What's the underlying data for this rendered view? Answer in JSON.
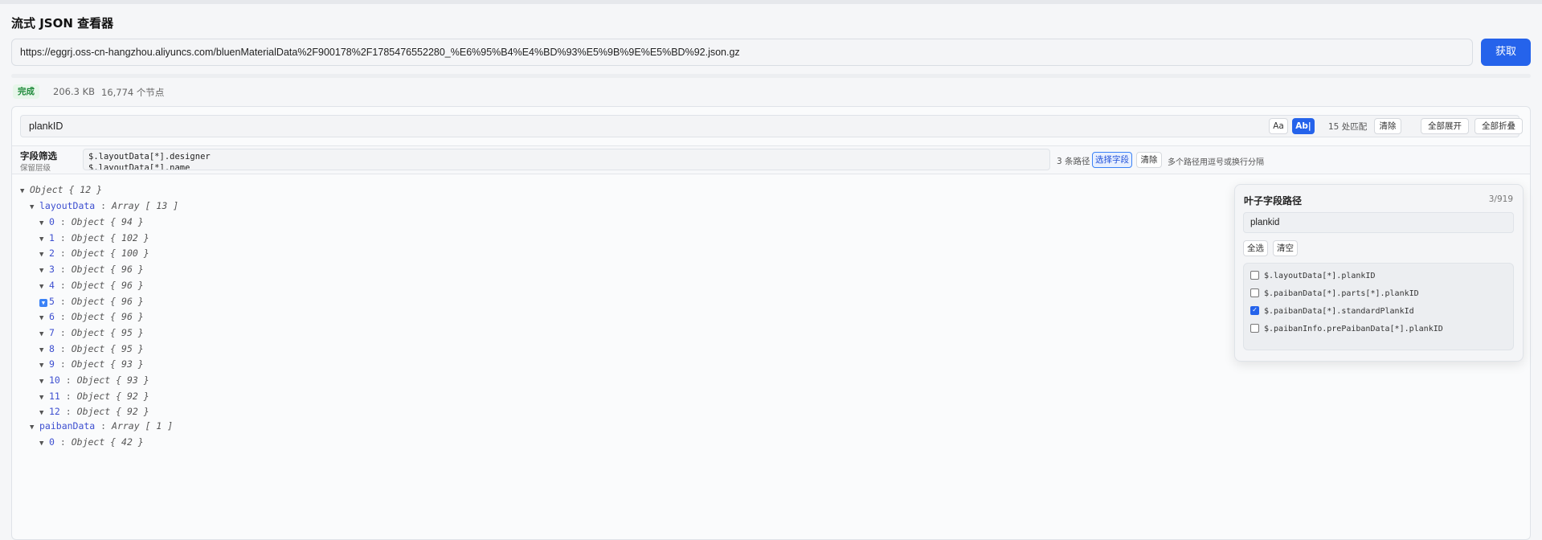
{
  "app": {
    "title": "流式 JSON 查看器"
  },
  "url_bar": {
    "value": "https://eggrj.oss-cn-hangzhou.aliyuncs.com/bluenMaterialData%2F900178%2F1785476552280_%E6%95%B4%E4%BD%93%E5%9B%9E%E5%BD%92.json.gz",
    "fetch_label": "获取"
  },
  "status": {
    "badge": "完成",
    "size": "206.3 KB",
    "nodes": "16,774 个节点"
  },
  "search": {
    "value": "plankID",
    "case_label": "Aa",
    "word_label": "Ab|",
    "match_count": "15 处匹配",
    "clear_label": "清除",
    "expand_all": "全部展开",
    "collapse_all": "全部折叠"
  },
  "field_filter": {
    "title": "字段筛选",
    "subtitle": "保留层级",
    "lines": [
      "$.layoutData[*].designer",
      "$.layoutData[*].name"
    ],
    "path_count": "3 条路径",
    "select_label": "选择字段",
    "clear_label": "清除",
    "hint": "多个路径用逗号或换行分隔"
  },
  "tree": {
    "root_type": "Object { 12 }",
    "layoutData": {
      "key": "layoutData",
      "type": "Array [ 13 ]"
    },
    "layout_items": [
      {
        "key": "0",
        "type": "Object { 94 }"
      },
      {
        "key": "1",
        "type": "Object { 102 }"
      },
      {
        "key": "2",
        "type": "Object { 100 }"
      },
      {
        "key": "3",
        "type": "Object { 96 }"
      },
      {
        "key": "4",
        "type": "Object { 96 }"
      },
      {
        "key": "5",
        "type": "Object { 96 }"
      },
      {
        "key": "6",
        "type": "Object { 96 }"
      },
      {
        "key": "7",
        "type": "Object { 95 }"
      },
      {
        "key": "8",
        "type": "Object { 95 }"
      },
      {
        "key": "9",
        "type": "Object { 93 }"
      },
      {
        "key": "10",
        "type": "Object { 93 }"
      },
      {
        "key": "11",
        "type": "Object { 92 }"
      },
      {
        "key": "12",
        "type": "Object { 92 }"
      }
    ],
    "paibanData": {
      "key": "paibanData",
      "type": "Array [ 1 ]"
    },
    "paiban_items": [
      {
        "key": "0",
        "type": "Object { 42 }"
      }
    ]
  },
  "leaf_picker": {
    "title": "叶子字段路径",
    "count": "3/919",
    "filter_value": "plankid",
    "select_all": "全选",
    "clear_all": "清空",
    "options": [
      {
        "path": "$.layoutData[*].plankID",
        "checked": false
      },
      {
        "path": "$.paibanData[*].parts[*].plankID",
        "checked": false
      },
      {
        "path": "$.paibanData[*].standardPlankId",
        "checked": true
      },
      {
        "path": "$.paibanInfo.prePaibanData[*].plankID",
        "checked": false
      }
    ]
  },
  "colors": {
    "accent": "#2563eb",
    "key": "#3d4fd0",
    "success": "#1f8a3b"
  }
}
